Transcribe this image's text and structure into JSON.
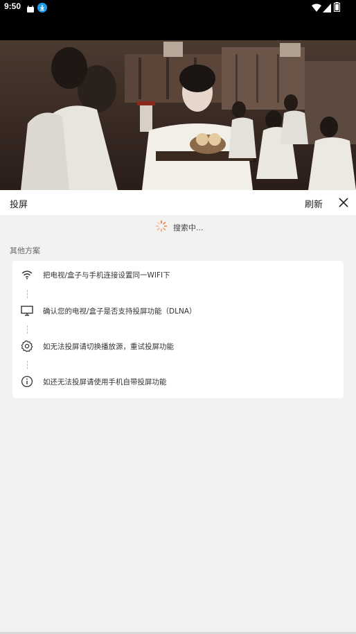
{
  "status_bar": {
    "time": "9:50",
    "icons": [
      "notification-icon",
      "download-icon",
      "wifi-icon",
      "signal-icon",
      "battery-icon"
    ]
  },
  "header": {
    "title": "投屏",
    "refresh_label": "刷新",
    "close_icon": "close-icon"
  },
  "search": {
    "status_text": "搜索中..."
  },
  "section": {
    "title": "其他方案"
  },
  "steps": [
    {
      "icon": "wifi-icon",
      "text": "把电视/盒子与手机连接设置同一WIFI下"
    },
    {
      "icon": "tv-icon",
      "text": "确认您的电视/盒子是否支持投屏功能（DLNA）"
    },
    {
      "icon": "gear-icon",
      "text": "如无法投屏请切换播放源，重试投屏功能"
    },
    {
      "icon": "info-icon",
      "text": "如还无法投屏请使用手机自带投屏功能"
    }
  ],
  "colors": {
    "accent": "#f07a3a",
    "background": "#f2f2f2",
    "card": "#ffffff"
  }
}
